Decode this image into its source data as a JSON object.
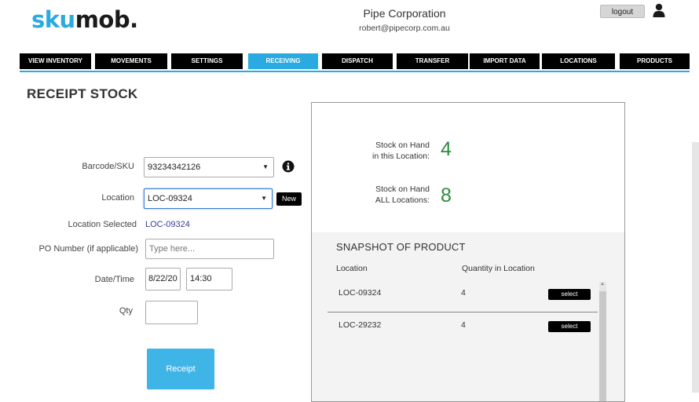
{
  "logo": {
    "part1": "sku",
    "part2": "mob."
  },
  "header": {
    "company": "Pipe Corporation",
    "email": "robert@pipecorp.com.au",
    "logout_label": "logout",
    "user_icon": "user-icon"
  },
  "nav": [
    {
      "label": "VIEW INVENTORY"
    },
    {
      "label": "MOVEMENTS"
    },
    {
      "label": "SETTINGS"
    },
    {
      "label": "RECEIVING",
      "active": true
    },
    {
      "label": "DISPATCH"
    },
    {
      "label": "TRANSFER"
    },
    {
      "label": "IMPORT DATA"
    },
    {
      "label": "LOCATIONS"
    },
    {
      "label": "PRODUCTS"
    }
  ],
  "page_title": "RECEIPT STOCK",
  "form": {
    "barcode_label": "Barcode/SKU",
    "barcode_value": "93234342126",
    "location_label": "Location",
    "location_value": "LOC-09324",
    "new_label": "New",
    "location_selected_label": "Location Selected",
    "location_selected_value": "LOC-09324",
    "po_label": "PO Number (if applicable)",
    "po_placeholder": "Type here...",
    "datetime_label": "Date/Time",
    "date_value": "8/22/20",
    "time_value": "14:30",
    "qty_label": "Qty",
    "qty_value": "",
    "receipt_label": "Receipt",
    "info_icon": "info-icon"
  },
  "stats": {
    "location_label_1": "Stock on Hand",
    "location_label_2": "in this Location:",
    "location_value": "4",
    "all_label_1": "Stock on Hand",
    "all_label_2": "ALL Locations:",
    "all_value": "8"
  },
  "snapshot": {
    "title": "SNAPSHOT OF PRODUCT",
    "col_location": "Location",
    "col_qty": "Quantity in Location",
    "rows": [
      {
        "location": "LOC-09324",
        "qty": "4",
        "action": "select"
      },
      {
        "location": "LOC-29232",
        "qty": "4",
        "action": "select"
      }
    ]
  },
  "colors": {
    "accent": "#29abe2",
    "stat_green": "#2e8b3e",
    "nav_bg": "#000000"
  }
}
